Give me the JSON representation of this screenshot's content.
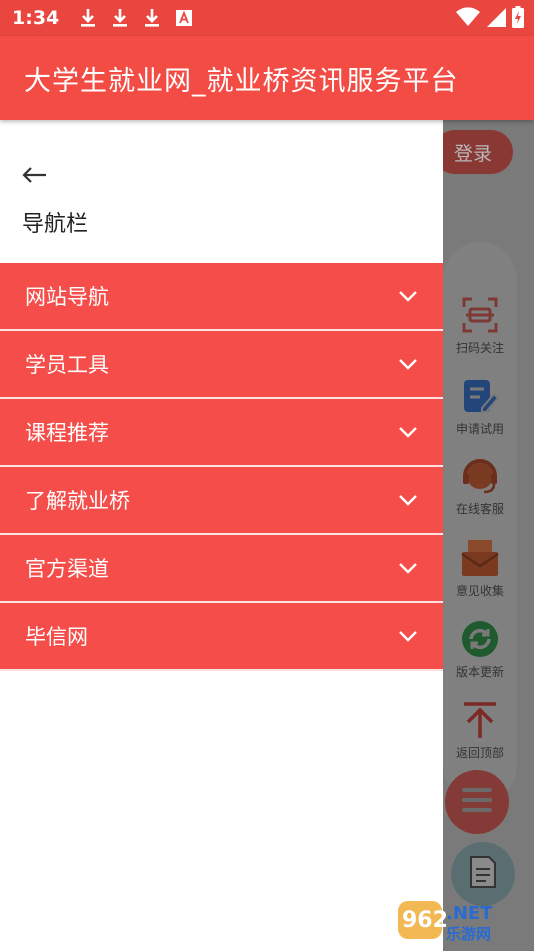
{
  "status_bar": {
    "time": "1:34",
    "icons": [
      "download-icon",
      "download-icon",
      "download-icon",
      "font-icon",
      "wifi-icon",
      "signal-icon",
      "battery-charging-icon"
    ]
  },
  "app_bar": {
    "title": "大学生就业网_就业桥资讯服务平台"
  },
  "drawer": {
    "title": "导航栏",
    "items": [
      {
        "label": "网站导航"
      },
      {
        "label": "学员工具"
      },
      {
        "label": "课程推荐"
      },
      {
        "label": "了解就业桥"
      },
      {
        "label": "官方渠道"
      },
      {
        "label": "毕信网"
      }
    ]
  },
  "background_page": {
    "login_label": "登录",
    "side_tools": [
      {
        "label": "扫码关注",
        "icon": "scan-icon"
      },
      {
        "label": "申请试用",
        "icon": "edit-icon"
      },
      {
        "label": "在线客服",
        "icon": "headset-icon"
      },
      {
        "label": "意见收集",
        "icon": "mail-icon"
      },
      {
        "label": "版本更新",
        "icon": "refresh-icon"
      },
      {
        "label": "返回顶部",
        "icon": "arrow-up-icon"
      }
    ]
  },
  "watermark": {
    "brand": "962.NET",
    "sub": "乐游网"
  },
  "colors": {
    "status_bar": "#e8463f",
    "app_bar": "#f34c45",
    "menu_item": "#f54d4a",
    "scrim": "#7a7a7a"
  }
}
